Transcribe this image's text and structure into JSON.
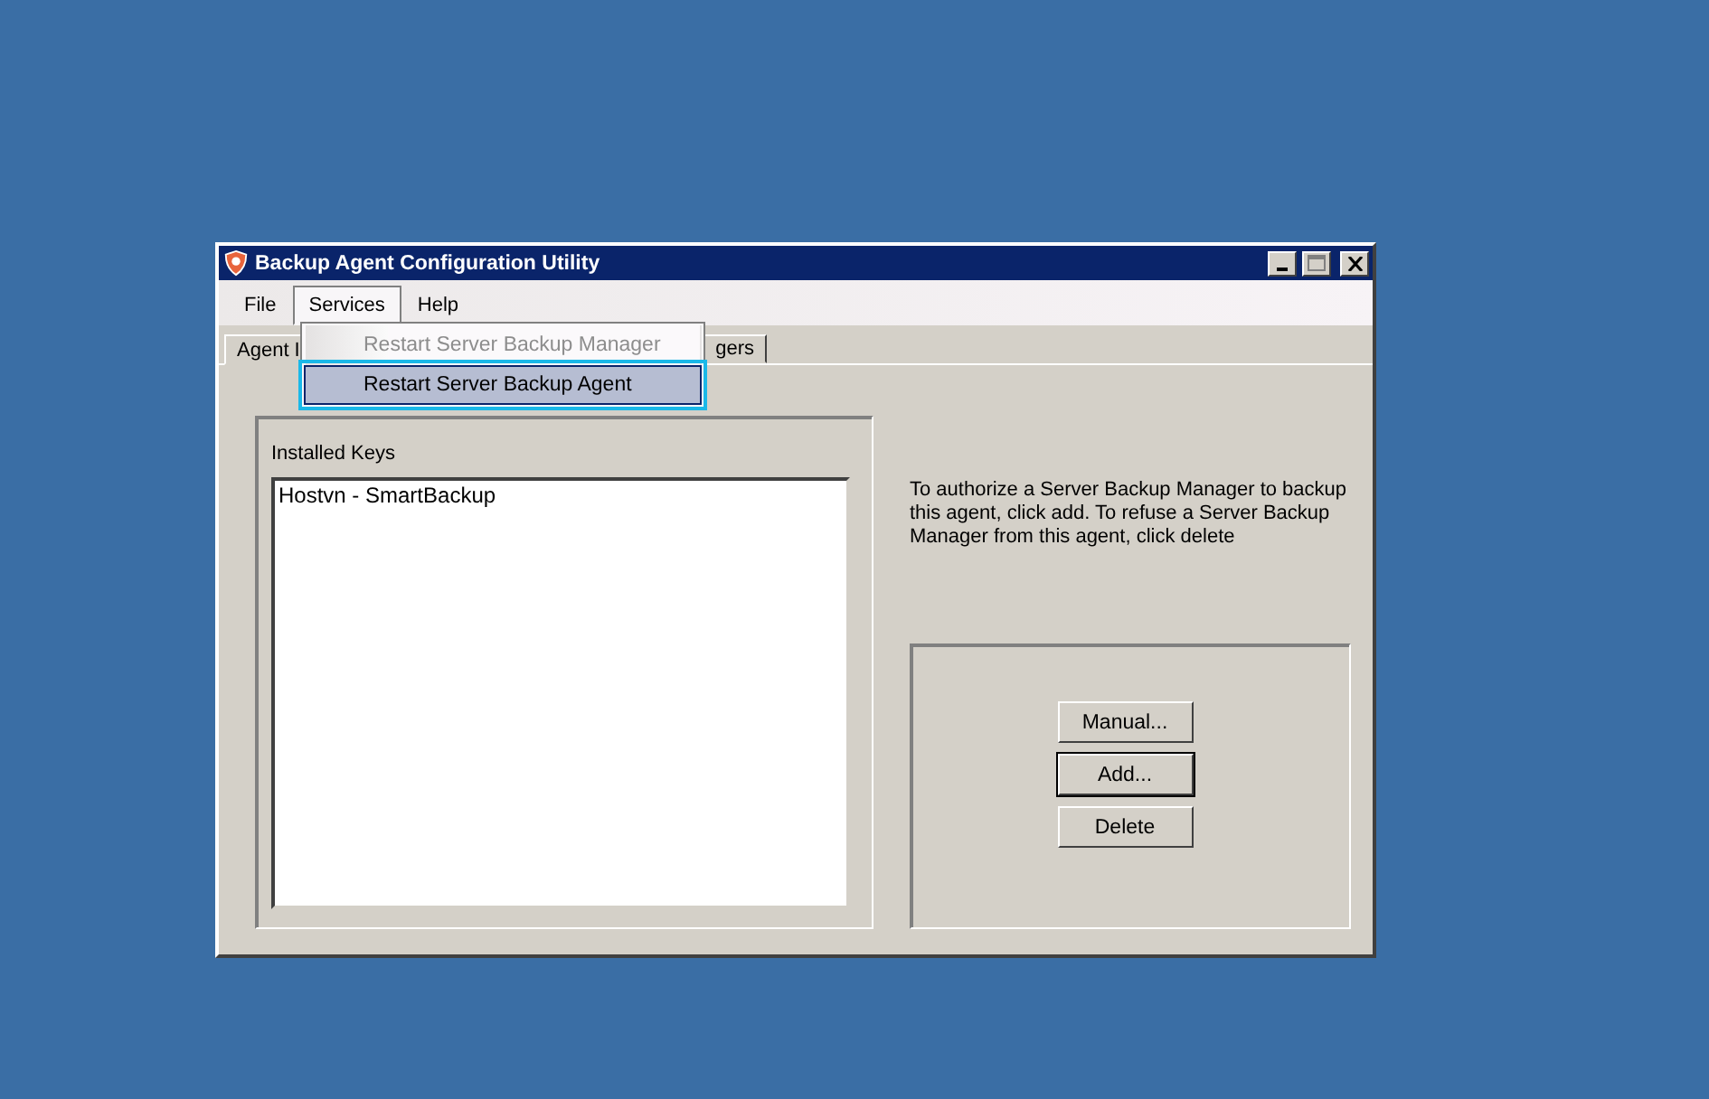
{
  "window": {
    "title": "Backup Agent Configuration Utility"
  },
  "menu": [
    {
      "label": "File",
      "selected": false
    },
    {
      "label": "Services",
      "selected": true
    },
    {
      "label": "Help",
      "selected": false
    }
  ],
  "dropdown": [
    {
      "label": "Restart Server Backup Manager",
      "disabled": true,
      "selected": false
    },
    {
      "label": "Restart Server Backup Agent",
      "disabled": false,
      "selected": true
    }
  ],
  "tabs": [
    {
      "label": "Agent I",
      "selected": true
    },
    {
      "label": "gers",
      "selected": false
    }
  ],
  "installed_keys": {
    "label": "Installed Keys",
    "items": [
      "Hostvn - SmartBackup"
    ]
  },
  "instructions": "To authorize a Server Backup Manager to backup this agent, click add. To refuse a Server Backup Manager from this agent, click delete",
  "buttons": [
    {
      "label": "Manual...",
      "default": false
    },
    {
      "label": "Add...",
      "default": true
    },
    {
      "label": "Delete",
      "default": false
    }
  ]
}
